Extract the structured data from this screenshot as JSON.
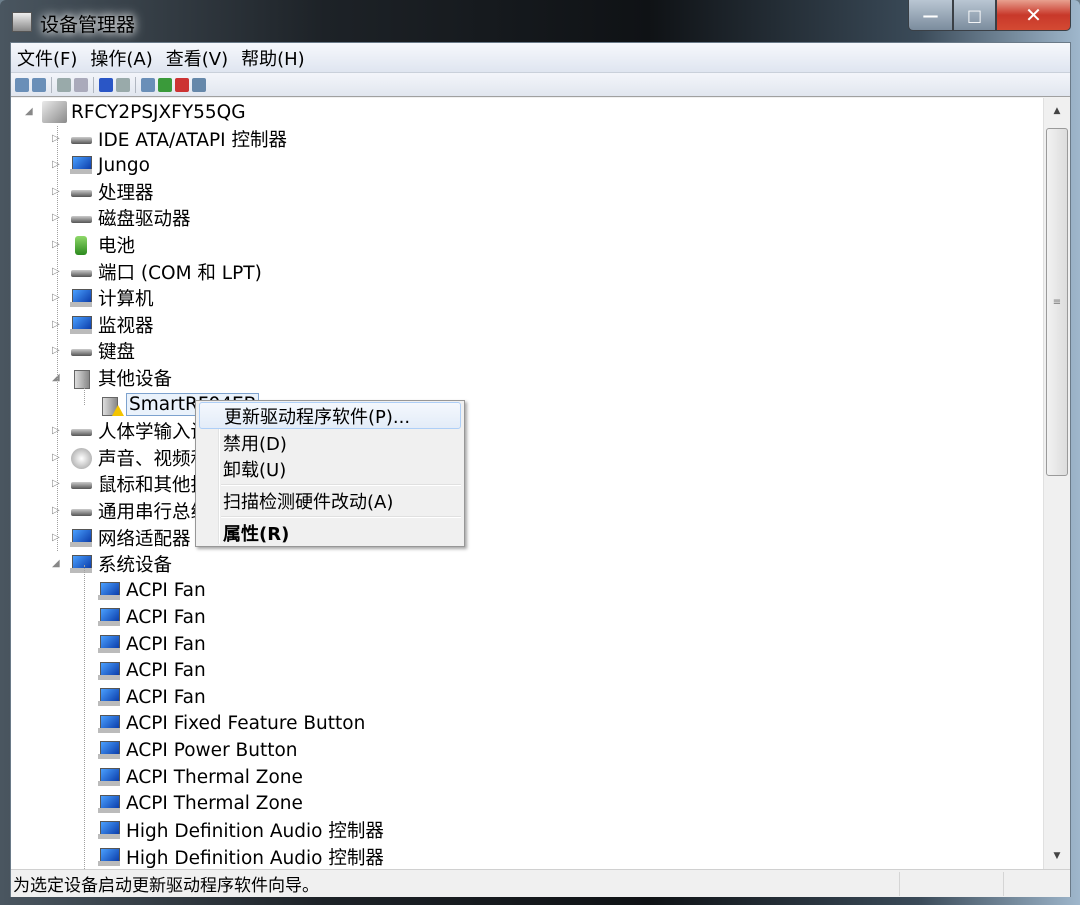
{
  "window": {
    "title": "设备管理器",
    "minimize": "—",
    "maximize": "□",
    "close": "✕"
  },
  "menu": [
    "文件(F)",
    "操作(A)",
    "查看(V)",
    "帮助(H)"
  ],
  "toolbar": [
    "back-icon",
    "forward-icon",
    "show-hide-tree-icon",
    "properties-icon",
    "help-icon",
    "view-icon",
    "scan-hardware-icon",
    "update-driver-icon",
    "disable-icon",
    "uninstall-icon"
  ],
  "tree": {
    "root": "RFCY2PSJXFY55QG",
    "items": [
      {
        "label": "IDE ATA/ATAPI 控制器",
        "level": 1,
        "icon": "flat",
        "expander": "▷"
      },
      {
        "label": "Jungo",
        "level": 1,
        "icon": "mon",
        "expander": "▷"
      },
      {
        "label": "处理器",
        "level": 1,
        "icon": "flat",
        "expander": "▷"
      },
      {
        "label": "磁盘驱动器",
        "level": 1,
        "icon": "flat",
        "expander": "▷"
      },
      {
        "label": "电池",
        "level": 1,
        "icon": "bat",
        "expander": "▷"
      },
      {
        "label": "端口 (COM 和 LPT)",
        "level": 1,
        "icon": "flat",
        "expander": "▷"
      },
      {
        "label": "计算机",
        "level": 1,
        "icon": "mon",
        "expander": "▷"
      },
      {
        "label": "监视器",
        "level": 1,
        "icon": "mon",
        "expander": "▷"
      },
      {
        "label": "键盘",
        "level": 1,
        "icon": "flat",
        "expander": "▷"
      },
      {
        "label": "其他设备",
        "level": 1,
        "icon": "dev",
        "expander": "◢"
      },
      {
        "label": "SmartRF04EB",
        "level": 2,
        "icon": "dev",
        "warning": true,
        "selected": true
      },
      {
        "label": "人体学输入设备",
        "level": 1,
        "icon": "flat",
        "expander": "▷"
      },
      {
        "label": "声音、视频和游戏控制器",
        "level": 1,
        "icon": "snd",
        "expander": "▷"
      },
      {
        "label": "鼠标和其他指针设备",
        "level": 1,
        "icon": "flat",
        "expander": "▷"
      },
      {
        "label": "通用串行总线控制器",
        "level": 1,
        "icon": "flat",
        "expander": "▷"
      },
      {
        "label": "网络适配器",
        "level": 1,
        "icon": "mon",
        "expander": "▷"
      },
      {
        "label": "系统设备",
        "level": 1,
        "icon": "mon",
        "expander": "◢"
      },
      {
        "label": "ACPI Fan",
        "level": 2,
        "icon": "mon"
      },
      {
        "label": "ACPI Fan",
        "level": 2,
        "icon": "mon"
      },
      {
        "label": "ACPI Fan",
        "level": 2,
        "icon": "mon"
      },
      {
        "label": "ACPI Fan",
        "level": 2,
        "icon": "mon"
      },
      {
        "label": "ACPI Fan",
        "level": 2,
        "icon": "mon"
      },
      {
        "label": "ACPI Fixed Feature Button",
        "level": 2,
        "icon": "mon"
      },
      {
        "label": "ACPI Power Button",
        "level": 2,
        "icon": "mon"
      },
      {
        "label": "ACPI Thermal Zone",
        "level": 2,
        "icon": "mon"
      },
      {
        "label": "ACPI Thermal Zone",
        "level": 2,
        "icon": "mon"
      },
      {
        "label": "High Definition Audio 控制器",
        "level": 2,
        "icon": "mon"
      },
      {
        "label": "High Definition Audio 控制器",
        "level": 2,
        "icon": "mon"
      }
    ]
  },
  "context_menu": {
    "items": [
      "更新驱动程序软件(P)...",
      "禁用(D)",
      "卸载(U)",
      "扫描检测硬件改动(A)",
      "属性(R)"
    ]
  },
  "status": {
    "text": "为选定设备启动更新驱动程序软件向导。"
  },
  "colors": {
    "selection": "#eaf2fb",
    "close": "#c8382a",
    "menu_highlight": "#e3ecf8"
  }
}
